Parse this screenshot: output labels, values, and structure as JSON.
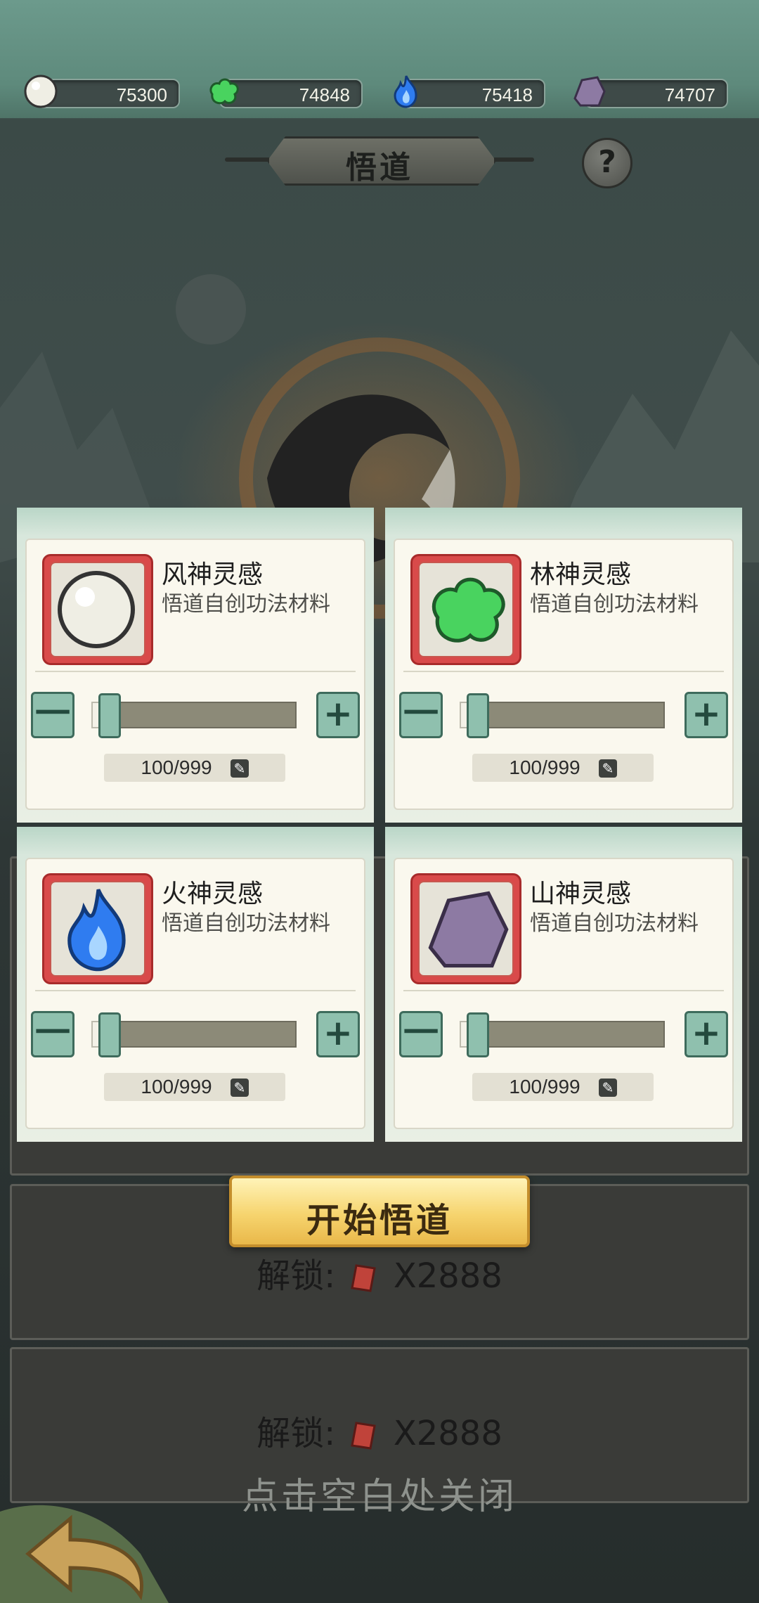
{
  "resources": [
    {
      "name": "wind",
      "value": "75300",
      "icon": "pearl-icon"
    },
    {
      "name": "forest",
      "value": "74848",
      "icon": "green-cloud-icon"
    },
    {
      "name": "fire",
      "value": "75418",
      "icon": "blue-flame-icon"
    },
    {
      "name": "mountain",
      "value": "74707",
      "icon": "purple-rock-icon"
    }
  ],
  "header": {
    "title": "悟道",
    "help": "?"
  },
  "cards": [
    {
      "name": "风神灵感",
      "desc": "悟道自创功法材料",
      "count": "100/999",
      "minus": "一",
      "plus": "+",
      "icon": "pearl-icon",
      "level": 0.1001
    },
    {
      "name": "林神灵感",
      "desc": "悟道自创功法材料",
      "count": "100/999",
      "minus": "一",
      "plus": "+",
      "icon": "green-cloud-icon",
      "level": 0.1001
    },
    {
      "name": "火神灵感",
      "desc": "悟道自创功法材料",
      "count": "100/999",
      "minus": "一",
      "plus": "+",
      "icon": "blue-flame-icon",
      "level": 0.1001
    },
    {
      "name": "山神灵感",
      "desc": "悟道自创功法材料",
      "count": "100/999",
      "minus": "一",
      "plus": "+",
      "icon": "purple-rock-icon",
      "level": 0.1001
    }
  ],
  "start_button": "开始悟道",
  "locked_slots": [
    {
      "label": "解锁:",
      "cost": "X2888"
    },
    {
      "label": "解锁:",
      "cost": "X2888"
    }
  ],
  "close_hint": "点击空白处关闭"
}
